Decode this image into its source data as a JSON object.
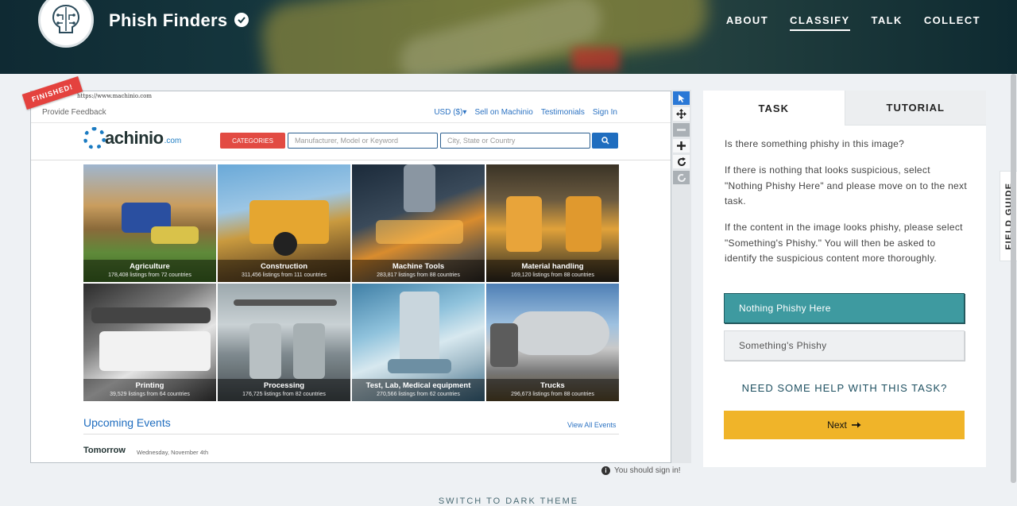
{
  "header": {
    "brand": "Phish Finders",
    "nav": [
      {
        "label": "ABOUT",
        "active": false
      },
      {
        "label": "CLASSIFY",
        "active": true
      },
      {
        "label": "TALK",
        "active": false
      },
      {
        "label": "COLLECT",
        "active": false
      }
    ]
  },
  "subject": {
    "ribbon": "FINISHED!",
    "url_text": "https://www.machinio.com",
    "site": {
      "feedback": "Provide Feedback",
      "util_links": [
        "USD ($)▾",
        "Sell on Machinio",
        "Testimonials",
        "Sign In"
      ],
      "logo_name": "machinio",
      "logo_tld": ".com",
      "categories_label": "CATEGORIES",
      "search_placeholder": "Manufacturer, Model or Keyword",
      "location_placeholder": "City, State or Country",
      "tiles": [
        {
          "title": "Agriculture",
          "sub": "178,408 listings from 72 countries"
        },
        {
          "title": "Construction",
          "sub": "311,456 listings from 111 countries"
        },
        {
          "title": "Machine Tools",
          "sub": "283,817 listings from 88 countries"
        },
        {
          "title": "Material handling",
          "sub": "169,120 listings from 88 countries"
        },
        {
          "title": "Printing",
          "sub": "39,529 listings from 64 countries"
        },
        {
          "title": "Processing",
          "sub": "176,725 listings from 82 countries"
        },
        {
          "title": "Test, Lab, Medical equipment",
          "sub": "270,566 listings from 62 countries"
        },
        {
          "title": "Trucks",
          "sub": "296,673 listings from 88 countries"
        }
      ],
      "events_title": "Upcoming Events",
      "view_all": "View All Events",
      "tomorrow": "Tomorrow",
      "tomorrow_date": "Wednesday, November 4th"
    },
    "tools": [
      "pointer-icon",
      "move-icon",
      "zoom-out-icon",
      "zoom-in-icon",
      "rotate-icon",
      "reset-icon"
    ],
    "signin_note": "You should sign in!"
  },
  "task": {
    "tabs": [
      "TASK",
      "TUTORIAL"
    ],
    "question": "Is there something phishy in this image?",
    "para1": "If there is nothing that looks suspicious, select \"Nothing Phishy Here\" and please move on to the next task.",
    "para2": "If the content in the image looks phishy, please select \"Something's Phishy.\" You will then be asked to identify the suspicious content more thoroughly.",
    "answers": [
      {
        "label": "Nothing Phishy Here",
        "selected": true
      },
      {
        "label": "Something's Phishy",
        "selected": false
      }
    ],
    "help": "NEED SOME HELP WITH THIS TASK?",
    "next": "Next"
  },
  "field_guide": "FIELD GUIDE",
  "dark_theme": "SWITCH TO DARK THEME",
  "colors": {
    "accent_teal": "#3e9aa0",
    "next_yellow": "#f0b429",
    "ribbon_red": "#e4423e",
    "link_blue": "#2b72c2"
  }
}
